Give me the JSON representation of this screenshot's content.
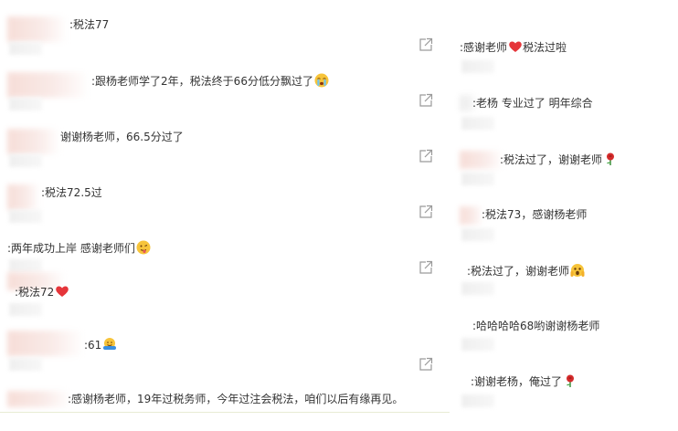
{
  "left_comments": [
    {
      "text": ":税法77"
    },
    {
      "text": ":跟杨老师学了2年，税法终于66分低分飘过了"
    },
    {
      "text": "谢谢杨老师，66.5分过了"
    },
    {
      "text": ":税法72.5过"
    },
    {
      "text": ":两年成功上岸 感谢老师们"
    },
    {
      "text": ":税法72"
    },
    {
      "text": ":61"
    },
    {
      "text": ":感谢杨老师，19年过税务师，今年过注会税法，咱们以后有缘再见。"
    }
  ],
  "right_comments": [
    {
      "text": ":感谢老师",
      "text2": "税法过啦"
    },
    {
      "text": ":老杨  专业过了  明年综合"
    },
    {
      "text": ":税法过了，谢谢老师"
    },
    {
      "text": ":税法73，感谢杨老师"
    },
    {
      "text": ":税法过了，谢谢老师"
    },
    {
      "text": ":哈哈哈哈68哟谢谢杨老师"
    },
    {
      "text": ":谢谢老杨，俺过了"
    }
  ],
  "icons": {
    "share": "share-external-icon",
    "crying_emoji": "crying-face-icon",
    "tongue_emoji": "tongue-face-icon",
    "heart": "red-heart-icon",
    "hug_emoji": "hugging-face-icon",
    "rose": "rose-icon",
    "scream_emoji": "scream-face-icon"
  },
  "colors": {
    "text": "#333333",
    "heart": "#e5353a",
    "rose": "#d42b2b",
    "emoji_yellow": "#f7c43a"
  }
}
